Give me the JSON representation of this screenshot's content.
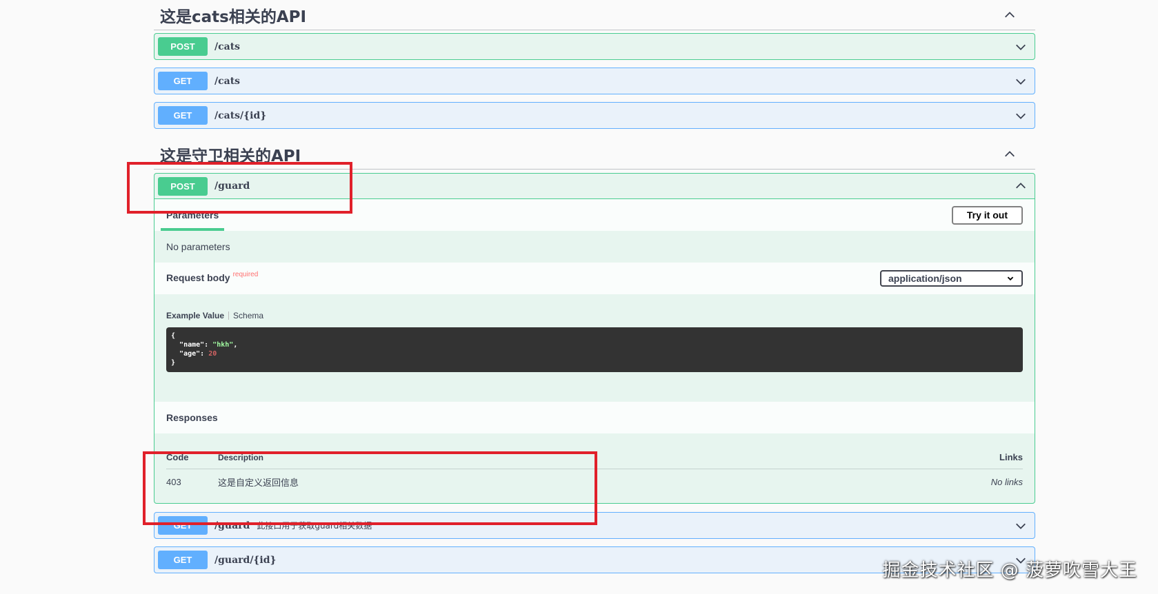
{
  "groups": [
    {
      "title": "这是cats相关的API",
      "operations": [
        {
          "method": "POST",
          "path": "/cats",
          "description": ""
        },
        {
          "method": "GET",
          "path": "/cats",
          "description": ""
        },
        {
          "method": "GET",
          "path": "/cats/{id}",
          "description": ""
        }
      ]
    },
    {
      "title": "这是守卫相关的API",
      "operations": [
        {
          "method": "POST",
          "path": "/guard",
          "description": ""
        },
        {
          "method": "GET",
          "path": "/guard",
          "description": "此接口用于获取guard相关数据"
        },
        {
          "method": "GET",
          "path": "/guard/{id}",
          "description": ""
        }
      ]
    }
  ],
  "expanded": {
    "parameters_tab": "Parameters",
    "try_button": "Try it out",
    "no_parameters": "No parameters",
    "request_body_label": "Request body",
    "required_label": "required",
    "content_type": "application/json",
    "example_tab": "Example Value",
    "schema_tab": "Schema",
    "example": {
      "open": "{",
      "name_key": "\"name\"",
      "name_val": "\"hkh\"",
      "age_key": "\"age\"",
      "age_val": "20",
      "close": "}"
    },
    "responses_label": "Responses",
    "table_headers": {
      "code": "Code",
      "description": "Description",
      "links": "Links"
    },
    "responses": [
      {
        "code": "403",
        "description": "这是自定义返回信息",
        "links": "No links"
      }
    ]
  },
  "watermark": "掘金技术社区 @ 菠萝吹雪大王",
  "colors": {
    "post": "#49cc90",
    "get": "#61affe",
    "highlight": "#e0202a"
  }
}
